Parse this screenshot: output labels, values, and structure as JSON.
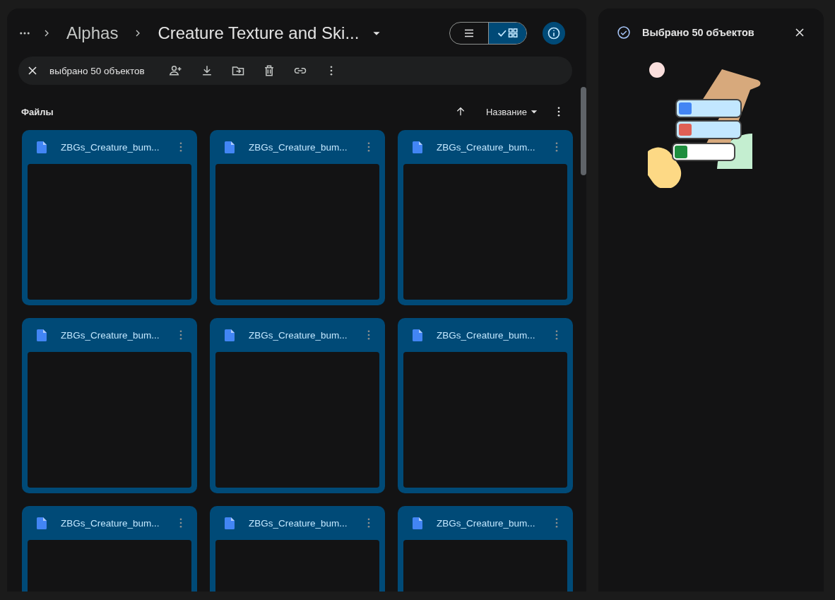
{
  "breadcrumbs": [
    {
      "label": "Alphas"
    },
    {
      "label": "Creature Texture and Ski..."
    }
  ],
  "view_toggle": [
    {
      "kind": "list",
      "selected": false
    },
    {
      "kind": "grid",
      "selected": true
    }
  ],
  "selection_bar": {
    "label": "выбрано 50 объектов"
  },
  "section": {
    "title": "Файлы",
    "sort_label": "Название"
  },
  "files": [
    {
      "name": "ZBGs_Creature_bum...",
      "selected": true
    },
    {
      "name": "ZBGs_Creature_bum...",
      "selected": true
    },
    {
      "name": "ZBGs_Creature_bum...",
      "selected": true
    },
    {
      "name": "ZBGs_Creature_bum...",
      "selected": true
    },
    {
      "name": "ZBGs_Creature_bum...",
      "selected": true
    },
    {
      "name": "ZBGs_Creature_bum...",
      "selected": true
    },
    {
      "name": "ZBGs_Creature_bum...",
      "selected": true
    },
    {
      "name": "ZBGs_Creature_bum...",
      "selected": true
    },
    {
      "name": "ZBGs_Creature_bum...",
      "selected": true
    }
  ],
  "details": {
    "title": "Выбрано 50 объектов"
  }
}
